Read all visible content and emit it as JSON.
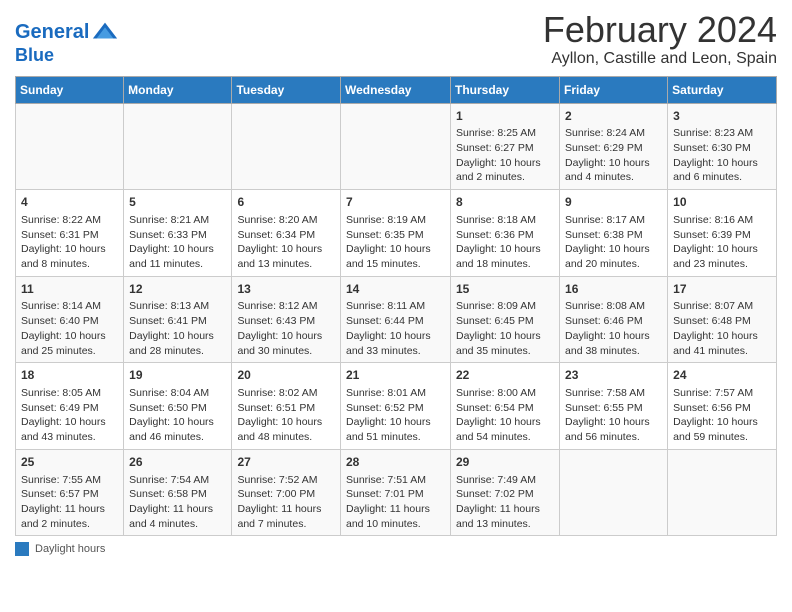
{
  "header": {
    "logo_line1": "General",
    "logo_line2": "Blue",
    "title": "February 2024",
    "subtitle": "Ayllon, Castille and Leon, Spain"
  },
  "columns": [
    "Sunday",
    "Monday",
    "Tuesday",
    "Wednesday",
    "Thursday",
    "Friday",
    "Saturday"
  ],
  "legend": "Daylight hours",
  "weeks": [
    [
      {
        "day": "",
        "info": ""
      },
      {
        "day": "",
        "info": ""
      },
      {
        "day": "",
        "info": ""
      },
      {
        "day": "",
        "info": ""
      },
      {
        "day": "1",
        "info": "Sunrise: 8:25 AM\nSunset: 6:27 PM\nDaylight: 10 hours and 2 minutes."
      },
      {
        "day": "2",
        "info": "Sunrise: 8:24 AM\nSunset: 6:29 PM\nDaylight: 10 hours and 4 minutes."
      },
      {
        "day": "3",
        "info": "Sunrise: 8:23 AM\nSunset: 6:30 PM\nDaylight: 10 hours and 6 minutes."
      }
    ],
    [
      {
        "day": "4",
        "info": "Sunrise: 8:22 AM\nSunset: 6:31 PM\nDaylight: 10 hours and 8 minutes."
      },
      {
        "day": "5",
        "info": "Sunrise: 8:21 AM\nSunset: 6:33 PM\nDaylight: 10 hours and 11 minutes."
      },
      {
        "day": "6",
        "info": "Sunrise: 8:20 AM\nSunset: 6:34 PM\nDaylight: 10 hours and 13 minutes."
      },
      {
        "day": "7",
        "info": "Sunrise: 8:19 AM\nSunset: 6:35 PM\nDaylight: 10 hours and 15 minutes."
      },
      {
        "day": "8",
        "info": "Sunrise: 8:18 AM\nSunset: 6:36 PM\nDaylight: 10 hours and 18 minutes."
      },
      {
        "day": "9",
        "info": "Sunrise: 8:17 AM\nSunset: 6:38 PM\nDaylight: 10 hours and 20 minutes."
      },
      {
        "day": "10",
        "info": "Sunrise: 8:16 AM\nSunset: 6:39 PM\nDaylight: 10 hours and 23 minutes."
      }
    ],
    [
      {
        "day": "11",
        "info": "Sunrise: 8:14 AM\nSunset: 6:40 PM\nDaylight: 10 hours and 25 minutes."
      },
      {
        "day": "12",
        "info": "Sunrise: 8:13 AM\nSunset: 6:41 PM\nDaylight: 10 hours and 28 minutes."
      },
      {
        "day": "13",
        "info": "Sunrise: 8:12 AM\nSunset: 6:43 PM\nDaylight: 10 hours and 30 minutes."
      },
      {
        "day": "14",
        "info": "Sunrise: 8:11 AM\nSunset: 6:44 PM\nDaylight: 10 hours and 33 minutes."
      },
      {
        "day": "15",
        "info": "Sunrise: 8:09 AM\nSunset: 6:45 PM\nDaylight: 10 hours and 35 minutes."
      },
      {
        "day": "16",
        "info": "Sunrise: 8:08 AM\nSunset: 6:46 PM\nDaylight: 10 hours and 38 minutes."
      },
      {
        "day": "17",
        "info": "Sunrise: 8:07 AM\nSunset: 6:48 PM\nDaylight: 10 hours and 41 minutes."
      }
    ],
    [
      {
        "day": "18",
        "info": "Sunrise: 8:05 AM\nSunset: 6:49 PM\nDaylight: 10 hours and 43 minutes."
      },
      {
        "day": "19",
        "info": "Sunrise: 8:04 AM\nSunset: 6:50 PM\nDaylight: 10 hours and 46 minutes."
      },
      {
        "day": "20",
        "info": "Sunrise: 8:02 AM\nSunset: 6:51 PM\nDaylight: 10 hours and 48 minutes."
      },
      {
        "day": "21",
        "info": "Sunrise: 8:01 AM\nSunset: 6:52 PM\nDaylight: 10 hours and 51 minutes."
      },
      {
        "day": "22",
        "info": "Sunrise: 8:00 AM\nSunset: 6:54 PM\nDaylight: 10 hours and 54 minutes."
      },
      {
        "day": "23",
        "info": "Sunrise: 7:58 AM\nSunset: 6:55 PM\nDaylight: 10 hours and 56 minutes."
      },
      {
        "day": "24",
        "info": "Sunrise: 7:57 AM\nSunset: 6:56 PM\nDaylight: 10 hours and 59 minutes."
      }
    ],
    [
      {
        "day": "25",
        "info": "Sunrise: 7:55 AM\nSunset: 6:57 PM\nDaylight: 11 hours and 2 minutes."
      },
      {
        "day": "26",
        "info": "Sunrise: 7:54 AM\nSunset: 6:58 PM\nDaylight: 11 hours and 4 minutes."
      },
      {
        "day": "27",
        "info": "Sunrise: 7:52 AM\nSunset: 7:00 PM\nDaylight: 11 hours and 7 minutes."
      },
      {
        "day": "28",
        "info": "Sunrise: 7:51 AM\nSunset: 7:01 PM\nDaylight: 11 hours and 10 minutes."
      },
      {
        "day": "29",
        "info": "Sunrise: 7:49 AM\nSunset: 7:02 PM\nDaylight: 11 hours and 13 minutes."
      },
      {
        "day": "",
        "info": ""
      },
      {
        "day": "",
        "info": ""
      }
    ]
  ]
}
